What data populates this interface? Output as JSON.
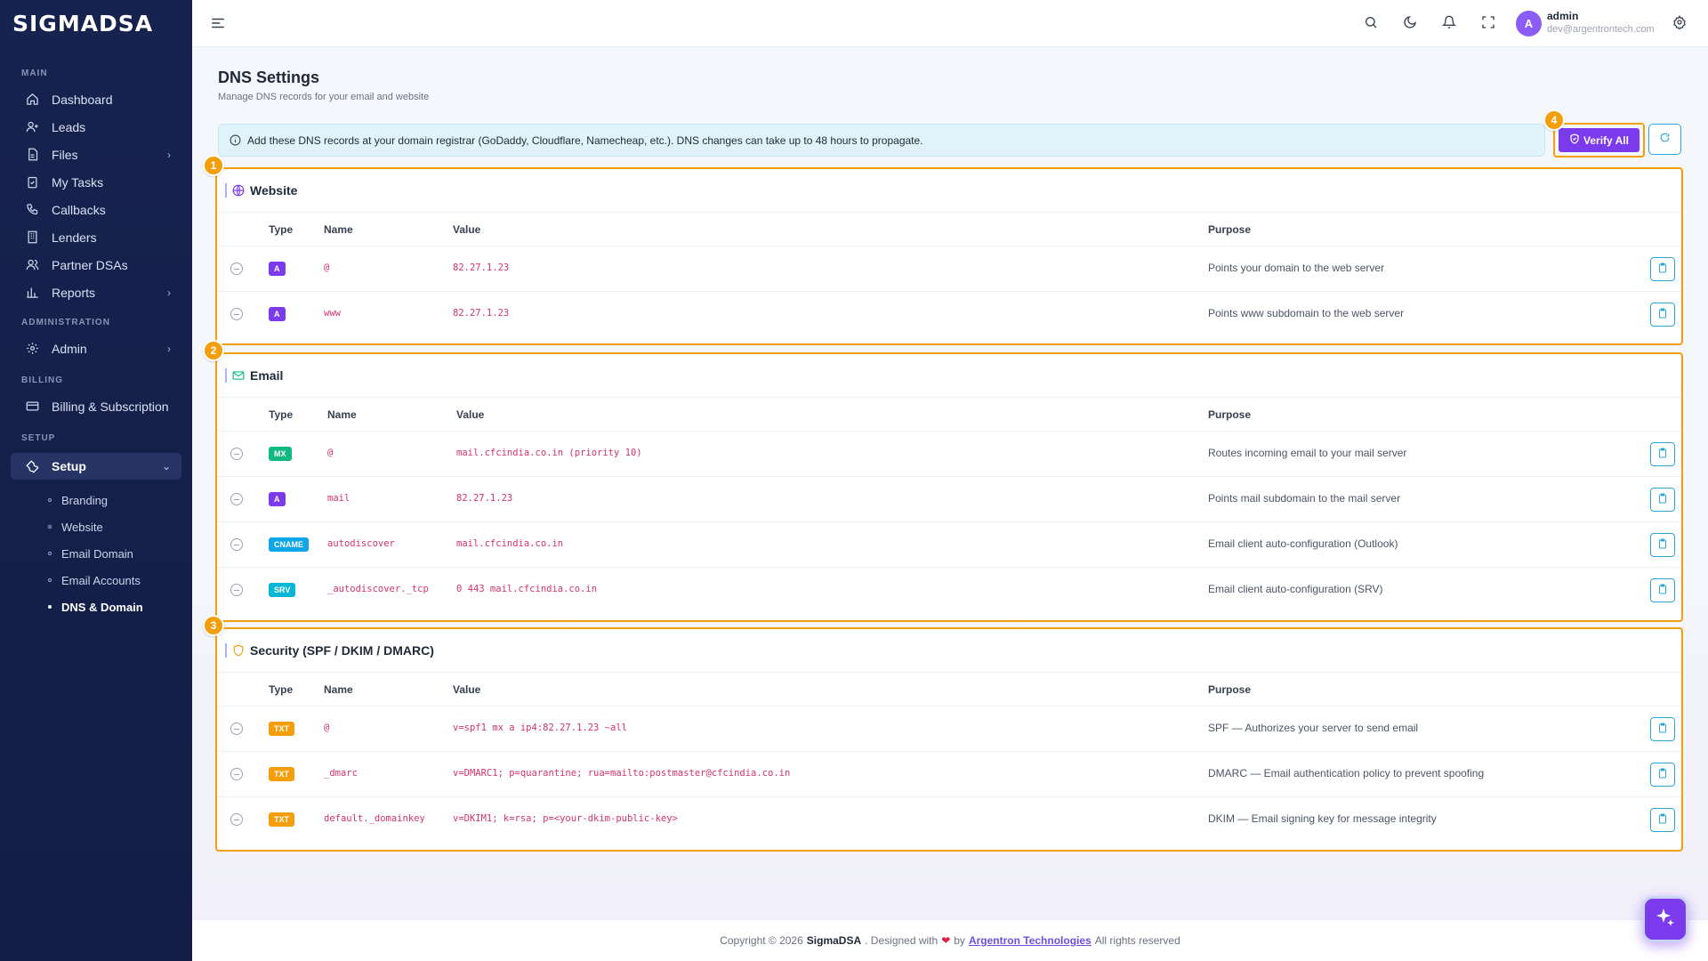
{
  "app": {
    "logo": "SIGMADSA"
  },
  "sidebar": {
    "sections": {
      "main": "MAIN",
      "administration": "ADMINISTRATION",
      "billing": "BILLING",
      "setup": "SETUP"
    },
    "main_items": [
      {
        "label": "Dashboard",
        "icon": "home-icon"
      },
      {
        "label": "Leads",
        "icon": "user-plus-icon"
      },
      {
        "label": "Files",
        "icon": "file-icon",
        "has_children": true
      },
      {
        "label": "My Tasks",
        "icon": "clipboard-check-icon"
      },
      {
        "label": "Callbacks",
        "icon": "phone-icon"
      },
      {
        "label": "Lenders",
        "icon": "building-icon"
      },
      {
        "label": "Partner DSAs",
        "icon": "users-icon"
      },
      {
        "label": "Reports",
        "icon": "bar-chart-icon",
        "has_children": true
      }
    ],
    "admin_item": {
      "label": "Admin",
      "icon": "gear-icon"
    },
    "billing_item": {
      "label": "Billing & Subscription",
      "icon": "credit-card-icon"
    },
    "setup_item": {
      "label": "Setup",
      "icon": "wrench-icon"
    },
    "setup_children": [
      "Branding",
      "Website",
      "Email Domain",
      "Email Accounts",
      "DNS & Domain"
    ],
    "active_child": "DNS & Domain"
  },
  "topbar": {
    "icons": [
      "menu-icon",
      "search-icon",
      "moon-icon",
      "bell-icon",
      "fullscreen-icon",
      "settings-icon"
    ],
    "avatar_letter": "A",
    "user_name": "admin",
    "user_email": "dev@argentrontech.com"
  },
  "page": {
    "title": "DNS Settings",
    "subtitle": "Manage DNS records for your email and website",
    "info": "Add these DNS records at your domain registrar (GoDaddy, Cloudflare, Namecheap, etc.). DNS changes can take up to 48 hours to propagate.",
    "verify_label": "Verify All",
    "callouts": [
      "1",
      "2",
      "3",
      "4"
    ]
  },
  "columns": {
    "type": "Type",
    "name": "Name",
    "value": "Value",
    "purpose": "Purpose"
  },
  "sections": {
    "website": {
      "title": "Website",
      "records": [
        {
          "type": "A",
          "name": "@",
          "value": "82.27.1.23",
          "purpose": "Points your domain to the web server"
        },
        {
          "type": "A",
          "name": "www",
          "value": "82.27.1.23",
          "purpose": "Points www subdomain to the web server"
        }
      ]
    },
    "email": {
      "title": "Email",
      "records": [
        {
          "type": "MX",
          "name": "@",
          "value": "mail.cfcindia.co.in (priority 10)",
          "purpose": "Routes incoming email to your mail server"
        },
        {
          "type": "A",
          "name": "mail",
          "value": "82.27.1.23",
          "purpose": "Points mail subdomain to the mail server"
        },
        {
          "type": "CNAME",
          "name": "autodiscover",
          "value": "mail.cfcindia.co.in",
          "purpose": "Email client auto-configuration (Outlook)"
        },
        {
          "type": "SRV",
          "name": "_autodiscover._tcp",
          "value": "0 443 mail.cfcindia.co.in",
          "purpose": "Email client auto-configuration (SRV)"
        }
      ]
    },
    "security": {
      "title": "Security (SPF / DKIM / DMARC)",
      "records": [
        {
          "type": "TXT",
          "name": "@",
          "value": "v=spf1 mx a ip4:82.27.1.23 ~all",
          "purpose": "SPF — Authorizes your server to send email"
        },
        {
          "type": "TXT",
          "name": "_dmarc",
          "value": "v=DMARC1; p=quarantine; rua=mailto:postmaster@cfcindia.co.in",
          "purpose": "DMARC — Email authentication policy to prevent spoofing"
        },
        {
          "type": "TXT",
          "name": "default._domainkey",
          "value": "v=DKIM1; k=rsa; p=<your-dkim-public-key>",
          "purpose": "DKIM — Email signing key for message integrity"
        }
      ]
    }
  },
  "type_colors": {
    "A": "#7c3aed",
    "MX": "#10b981",
    "CNAME": "#0ea5e9",
    "SRV": "#06b6d4",
    "TXT": "#f59e0b"
  },
  "colors": {
    "accent": "#7c3aed",
    "highlight": "#f59e0b",
    "info_bg": "#e0f3fb",
    "sidebar_bg": "#16234f"
  },
  "footer": {
    "prefix": "Copyright © 2026",
    "brand": "SigmaDSA",
    "middle": ". Designed with",
    "by": "by",
    "company": "Argentron Technologies",
    "suffix": "All rights reserved"
  }
}
